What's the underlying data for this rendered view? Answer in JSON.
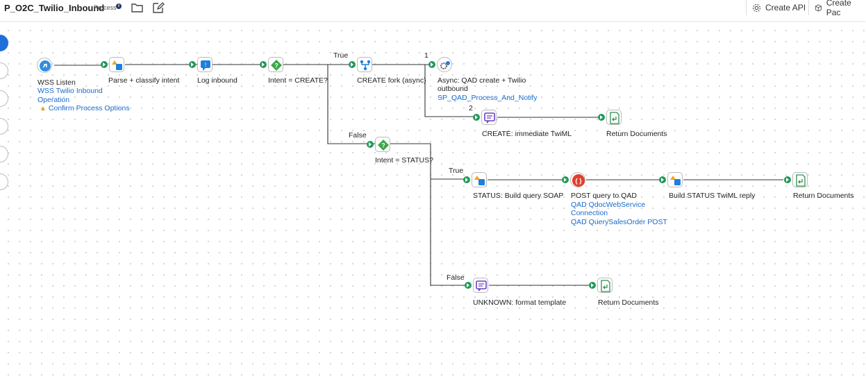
{
  "header": {
    "title": "P_O2C_Twilio_Inbound",
    "type_badge": "Process",
    "info_glyph": "i",
    "create_api_label": "Create API",
    "create_package_label": "Create Pac"
  },
  "nodes": {
    "wss_listen": {
      "label": "WSS Listen",
      "link1": "WSS Twilio Inbound",
      "link2": "Operation",
      "warning": "Confirm Process Options"
    },
    "parse": {
      "label": "Parse + classify intent"
    },
    "log": {
      "label": "Log inbound"
    },
    "intent_create": {
      "label": "Intent = CREATE?"
    },
    "create_fork": {
      "label": "CREATE fork (async)"
    },
    "async": {
      "label1": "Async: QAD create + Twilio",
      "label2": "outbound",
      "link": "SP_QAD_Process_And_Notify"
    },
    "create_twiml": {
      "label": "CREATE: immediate TwiML"
    },
    "return1": {
      "label": "Return Documents"
    },
    "intent_status": {
      "label": "Intent = STATUS?"
    },
    "status_soap": {
      "label": "STATUS: Build query SOAP"
    },
    "post_qad": {
      "label": "POST query to QAD",
      "link1": "QAD QdocWebService",
      "link2": "Connection",
      "link3": "QAD QuerySalesOrder POST"
    },
    "build_status": {
      "label": "Build STATUS TwiML reply"
    },
    "return2": {
      "label": "Return Documents"
    },
    "unknown": {
      "label": "UNKNOWN: format template"
    },
    "return3": {
      "label": "Return Documents"
    }
  },
  "edges": {
    "true1": "True",
    "false1": "False",
    "branch1": "1",
    "branch2": "2",
    "true2": "True",
    "false2": "False"
  },
  "colors": {
    "port_green": "#22995a",
    "link_blue": "#1a6bc9",
    "start_blue": "#2f8fe0",
    "message_purple": "#6b3fc7",
    "decision_green": "#3aa845",
    "connector_red": "#e0402f",
    "return_green": "#2f8f4a",
    "warning_amber": "#e8a21a"
  }
}
